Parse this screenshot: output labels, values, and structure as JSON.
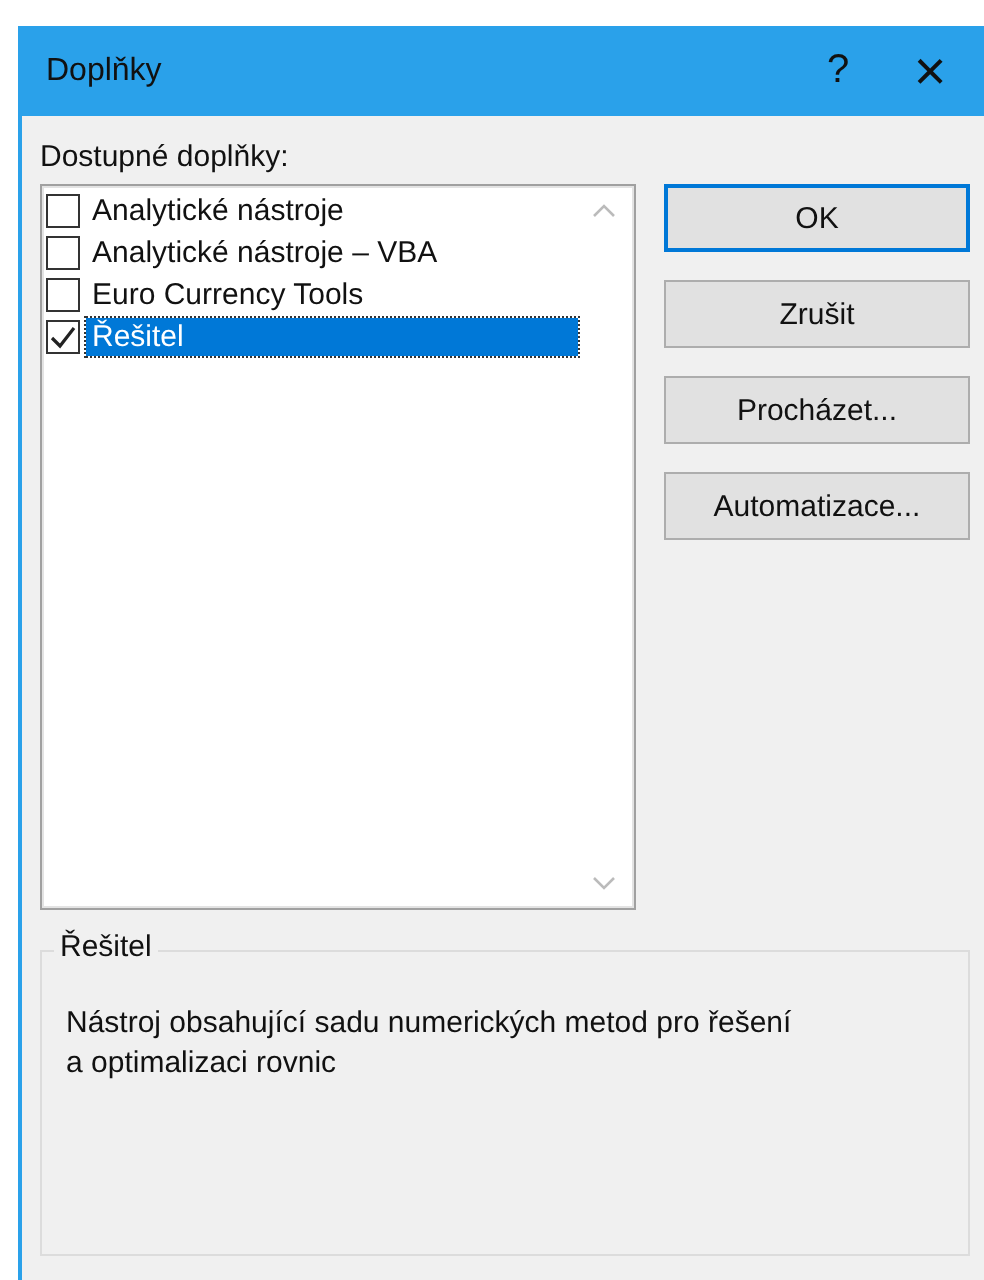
{
  "window": {
    "title": "Doplňky",
    "help": "?",
    "close": "×"
  },
  "list_label": "Dostupné doplňky:",
  "addins": [
    {
      "label": "Analytické nástroje",
      "checked": false,
      "selected": false
    },
    {
      "label": "Analytické nástroje – VBA",
      "checked": false,
      "selected": false
    },
    {
      "label": "Euro Currency Tools",
      "checked": false,
      "selected": false
    },
    {
      "label": "Řešitel",
      "checked": true,
      "selected": true
    }
  ],
  "buttons": [
    {
      "label": "OK",
      "default": true
    },
    {
      "label": "Zrušit",
      "default": false
    },
    {
      "label": "Procházet...",
      "default": false
    },
    {
      "label": "Automatizace...",
      "default": false
    }
  ],
  "description": {
    "title": "Řešitel",
    "text": "Nástroj obsahující sadu numerických metod pro řešení a optimalizaci rovnic"
  }
}
